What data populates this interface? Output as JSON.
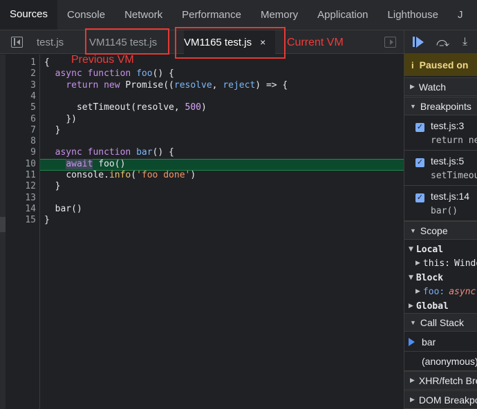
{
  "top_tabs": [
    "Sources",
    "Console",
    "Network",
    "Performance",
    "Memory",
    "Application",
    "Lighthouse",
    "J"
  ],
  "file_tabs": {
    "tab1": "test.js",
    "tab2": "VM1145 test.js",
    "tab3": "VM1165 test.js",
    "close_glyph": "×"
  },
  "annotations": {
    "previous": "Previous VM",
    "current": "Current VM",
    "color": "#e53935"
  },
  "editor": {
    "line_numbers": [
      "1",
      "2",
      "3",
      "4",
      "5",
      "6",
      "7",
      "8",
      "9",
      "10",
      "11",
      "12",
      "13",
      "14",
      "15"
    ],
    "highlighted_line": "10",
    "lines": {
      "l1": "{",
      "l2_kw": "async function",
      "l2_name": "foo",
      "l2_rest": "() {",
      "l3_kw1": "return new",
      "l3_cls": "Promise",
      "l3_p1": "resolve",
      "l3_p2": "reject",
      "l3_rest": "=> {",
      "l5_fn": "setTimeout",
      "l5_arg": "resolve",
      "l5_num": "500",
      "l6": "})",
      "l7": "}",
      "l9_kw": "async function",
      "l9_name": "bar",
      "l9_rest": "() {",
      "l10_kw": "await",
      "l10_rest": "foo()",
      "l11_obj": "console.",
      "l11_fn": "info",
      "l11_str": "'foo done'",
      "l12": "}",
      "l14": "bar()",
      "l15": "}"
    }
  },
  "debugger": {
    "paused": "Paused on",
    "watch": "Watch",
    "breakpoints_title": "Breakpoints",
    "breakpoints": [
      {
        "loc": "test.js:3",
        "src": "return new"
      },
      {
        "loc": "test.js:5",
        "src": "setTimeout"
      },
      {
        "loc": "test.js:14",
        "src": "bar()"
      }
    ],
    "scope_title": "Scope",
    "scope": {
      "local": "Local",
      "this_key": "this:",
      "this_val": "Window",
      "block": "Block",
      "foo_key": "foo:",
      "foo_val": "async",
      "global": "Global"
    },
    "callstack_title": "Call Stack",
    "callstack": [
      "bar",
      "(anonymous)"
    ],
    "xhr": "XHR/fetch Breakpoints",
    "dom": "DOM Breakpoints"
  }
}
